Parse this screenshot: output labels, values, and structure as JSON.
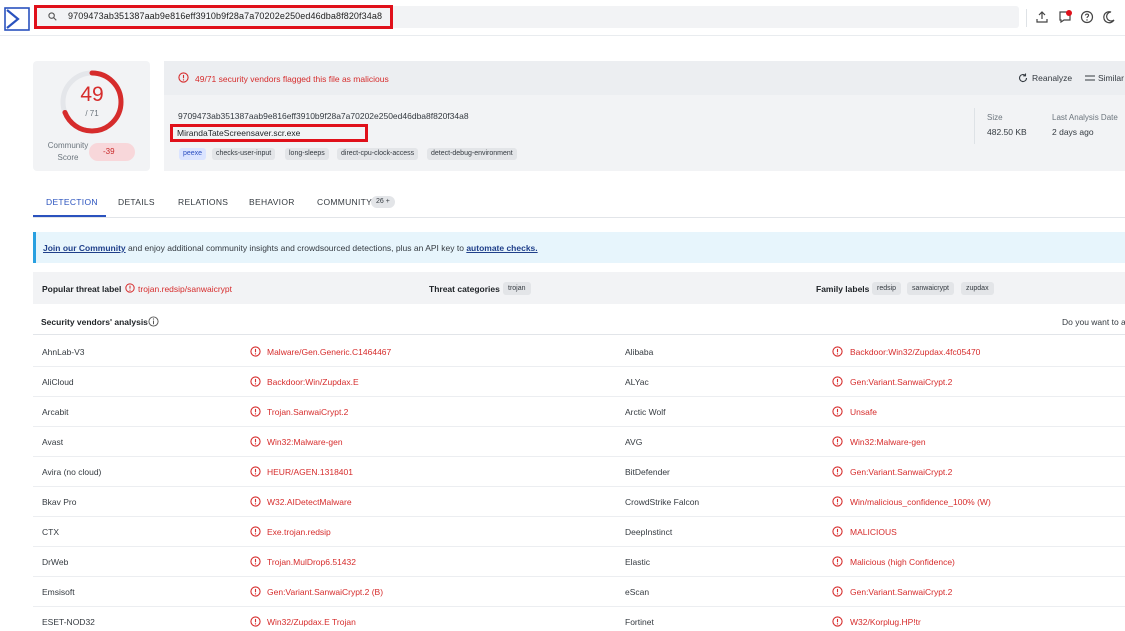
{
  "header": {
    "search_value": "9709473ab351387aab9e816eff3910b9f28a7a70202e250ed46dba8f820f34a8",
    "icons": [
      "logo-icon",
      "search-icon",
      "upload-icon",
      "notifications-icon",
      "help-icon",
      "theme-toggle-icon"
    ]
  },
  "summary": {
    "score": "49",
    "score_total": "/ 71",
    "community_label": "Community Score",
    "community_value": "-39",
    "flag_text": "49/71 security vendors flagged this file as malicious",
    "reanalyze": "Reanalyze",
    "similar": "Similar",
    "hash": "9709473ab351387aab9e816eff3910b9f28a7a70202e250ed46dba8f820f34a8",
    "filename": "MirandaTateScreensaver.scr.exe",
    "tags": [
      "peexe",
      "checks-user-input",
      "long-sleeps",
      "direct-cpu-clock-access",
      "detect-debug-environment"
    ],
    "size_label": "Size",
    "size_value": "482.50 KB",
    "last_analysis_label": "Last Analysis Date",
    "last_analysis_value": "2 days ago"
  },
  "tabs": [
    {
      "label": "DETECTION"
    },
    {
      "label": "DETAILS"
    },
    {
      "label": "RELATIONS"
    },
    {
      "label": "BEHAVIOR"
    },
    {
      "label": "COMMUNITY",
      "badge": "26 +"
    }
  ],
  "banner": {
    "link1": "Join our Community",
    "middle": " and enjoy additional community insights and crowdsourced detections, plus an API key to ",
    "link2": "automate checks."
  },
  "threat": {
    "popular_label": "Popular threat label",
    "popular_value": "trojan.redsip/sanwaicrypt",
    "categories_label": "Threat categories",
    "categories": [
      "trojan"
    ],
    "family_label": "Family labels",
    "families": [
      "redsip",
      "sanwaicrypt",
      "zupdax"
    ]
  },
  "vendors": {
    "title": "Security vendors' analysis",
    "want_to": "Do you want to a",
    "rows": [
      {
        "left_name": "AhnLab-V3",
        "left_result": "Malware/Gen.Generic.C1464467",
        "right_name": "Alibaba",
        "right_result": "Backdoor:Win32/Zupdax.4fc05470"
      },
      {
        "left_name": "AliCloud",
        "left_result": "Backdoor:Win/Zupdax.E",
        "right_name": "ALYac",
        "right_result": "Gen:Variant.SanwaiCrypt.2"
      },
      {
        "left_name": "Arcabit",
        "left_result": "Trojan.SanwaiCrypt.2",
        "right_name": "Arctic Wolf",
        "right_result": "Unsafe"
      },
      {
        "left_name": "Avast",
        "left_result": "Win32:Malware-gen",
        "right_name": "AVG",
        "right_result": "Win32:Malware-gen"
      },
      {
        "left_name": "Avira (no cloud)",
        "left_result": "HEUR/AGEN.1318401",
        "right_name": "BitDefender",
        "right_result": "Gen:Variant.SanwaiCrypt.2"
      },
      {
        "left_name": "Bkav Pro",
        "left_result": "W32.AIDetectMalware",
        "right_name": "CrowdStrike Falcon",
        "right_result": "Win/malicious_confidence_100% (W)"
      },
      {
        "left_name": "CTX",
        "left_result": "Exe.trojan.redsip",
        "right_name": "DeepInstinct",
        "right_result": "MALICIOUS"
      },
      {
        "left_name": "DrWeb",
        "left_result": "Trojan.MulDrop6.51432",
        "right_name": "Elastic",
        "right_result": "Malicious (high Confidence)"
      },
      {
        "left_name": "Emsisoft",
        "left_result": "Gen:Variant.SanwaiCrypt.2 (B)",
        "right_name": "eScan",
        "right_result": "Gen:Variant.SanwaiCrypt.2"
      },
      {
        "left_name": "ESET-NOD32",
        "left_result": "Win32/Zupdax.E Trojan",
        "right_name": "Fortinet",
        "right_result": "W32/Korplug.HP!tr"
      }
    ]
  },
  "colors": {
    "malicious": "#d62c2c",
    "accent": "#2a52be",
    "highlight_box": "#e0101a",
    "banner_bg": "#e7f5fc"
  }
}
